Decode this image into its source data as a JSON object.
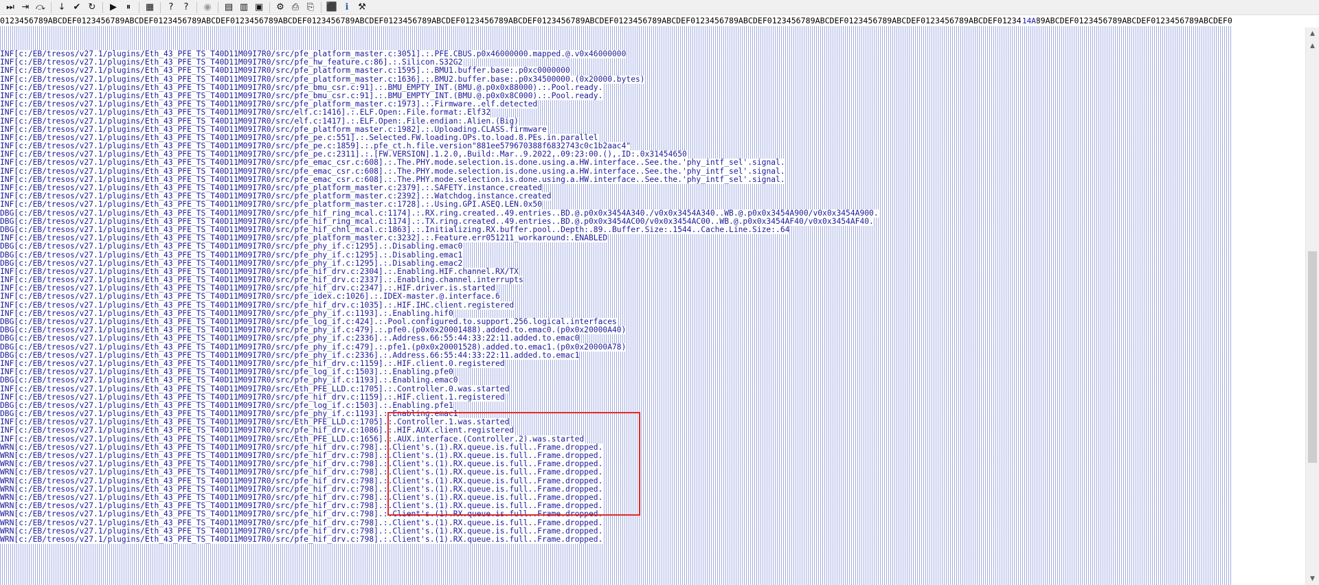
{
  "toolbar": {
    "buttons": [
      {
        "name": "run-to-end-icon",
        "glyph": "⏭"
      },
      {
        "name": "step-into-icon",
        "glyph": "⇥"
      },
      {
        "name": "step-over-icon",
        "glyph": "⤼"
      },
      {
        "name": "step-down-icon",
        "glyph": "↓"
      },
      {
        "name": "check-icon",
        "glyph": "✔"
      },
      {
        "name": "refresh-icon",
        "glyph": "↻"
      },
      {
        "name": "play-icon",
        "glyph": "▶"
      },
      {
        "name": "pause-icon",
        "glyph": "⏸"
      },
      {
        "name": "reset-icon",
        "glyph": "▦"
      },
      {
        "name": "help-icon",
        "glyph": "?"
      },
      {
        "name": "context-help-icon",
        "glyph": "?"
      },
      {
        "name": "disabled-icon",
        "glyph": "◉"
      },
      {
        "name": "grid-icon",
        "glyph": "▤"
      },
      {
        "name": "binary-icon",
        "glyph": "▥"
      },
      {
        "name": "memory-icon",
        "glyph": "▣"
      },
      {
        "name": "settings-icon",
        "glyph": "⚙"
      },
      {
        "name": "print-icon",
        "glyph": "⎙"
      },
      {
        "name": "export-icon",
        "glyph": "⎘"
      },
      {
        "name": "record-icon",
        "glyph": "⬛"
      },
      {
        "name": "info-icon",
        "glyph": "ℹ"
      },
      {
        "name": "tools-icon",
        "glyph": "⚒"
      }
    ]
  },
  "ruler": "0123456789ABCDEF0123456789ABCDEF0123456789ABCDEF0123456789ABCDEF0123456789ABCDEF0123456789ABCDEF0123456789ABCDEF0123456789ABCDEF0123456789ABCDEF0123456789ABCDEF0123456789ABCDEF0123456789ABCDEF0123456789ABCDEF0123456789ABCDEF0123456789ABCDEF0123456789ABCDEF0123456789ABCDEF0123456789ABCDEF",
  "position_label": "14A",
  "log_lines": [
    {
      "level": "INF",
      "src": "c:/EB/tresos/v27.1/plugins/Eth_43_PFE_TS_T40D11M09I7R0/src/pfe_platform_master.c:3051]",
      "msg": ".:.PFE.CBUS.p0x46000000.mapped.@.v0x46000000"
    },
    {
      "level": "INF",
      "src": "c:/EB/tresos/v27.1/plugins/Eth_43_PFE_TS_T40D11M09I7R0/src/pfe_hw_feature.c:86]",
      "msg": ".:.Silicon.S32G2"
    },
    {
      "level": "INF",
      "src": "c:/EB/tresos/v27.1/plugins/Eth_43_PFE_TS_T40D11M09I7R0/src/pfe_platform_master.c:1595]",
      "msg": ".:.BMU1.buffer.base:.p0xc0000000"
    },
    {
      "level": "INF",
      "src": "c:/EB/tresos/v27.1/plugins/Eth_43_PFE_TS_T40D11M09I7R0/src/pfe_platform_master.c:1636]",
      "msg": ".:.BMU2.buffer.base:.p0x34500000.(0x20000.bytes)"
    },
    {
      "level": "INF",
      "src": "c:/EB/tresos/v27.1/plugins/Eth_43_PFE_TS_T40D11M09I7R0/src/pfe_bmu_csr.c:91]",
      "msg": ".:.BMU_EMPTY_INT.(BMU.@.p0x0x88000).:.Pool.ready."
    },
    {
      "level": "INF",
      "src": "c:/EB/tresos/v27.1/plugins/Eth_43_PFE_TS_T40D11M09I7R0/src/pfe_bmu_csr.c:91]",
      "msg": ".:.BMU_EMPTY_INT.(BMU.@.p0x0x8C000).:.Pool.ready."
    },
    {
      "level": "INF",
      "src": "c:/EB/tresos/v27.1/plugins/Eth_43_PFE_TS_T40D11M09I7R0/src/pfe_platform_master.c:1973]",
      "msg": ".:.Firmware..elf.detected"
    },
    {
      "level": "INF",
      "src": "c:/EB/tresos/v27.1/plugins/Eth_43_PFE_TS_T40D11M09I7R0/src/elf.c:1416]",
      "msg": ".:.ELF.Open:.File.format:.Elf32"
    },
    {
      "level": "INF",
      "src": "c:/EB/tresos/v27.1/plugins/Eth_43_PFE_TS_T40D11M09I7R0/src/elf.c:1417]",
      "msg": ".:.ELF.Open:.File.endian:.Alien.(Big)"
    },
    {
      "level": "INF",
      "src": "c:/EB/tresos/v27.1/plugins/Eth_43_PFE_TS_T40D11M09I7R0/src/pfe_platform_master.c:1982]",
      "msg": ".:.Uploading.CLASS.firmware"
    },
    {
      "level": "INF",
      "src": "c:/EB/tresos/v27.1/plugins/Eth_43_PFE_TS_T40D11M09I7R0/src/pfe_pe.c:551]",
      "msg": ".:.Selected.FW.loading.OPs.to.load.8.PEs.in.parallel"
    },
    {
      "level": "INF",
      "src": "c:/EB/tresos/v27.1/plugins/Eth_43_PFE_TS_T40D11M09I7R0/src/pfe_pe.c:1859]",
      "msg": ".:.pfe_ct.h.file.version\"881ee579670388f6832743c0c1b2aac4\""
    },
    {
      "level": "INF",
      "src": "c:/EB/tresos/v27.1/plugins/Eth_43_PFE_TS_T40D11M09I7R0/src/pfe_pe.c:2311]",
      "msg": ".:.[FW.VERSION].1.2.0,.Build:.Mar..9.2022,.09:23:00.(),.ID:.0x31454650"
    },
    {
      "level": "INF",
      "src": "c:/EB/tresos/v27.1/plugins/Eth_43_PFE_TS_T40D11M09I7R0/src/pfe_emac_csr.c:608]",
      "msg": ".:.The.PHY.mode.selection.is.done.using.a.HW.interface..See.the.'phy_intf_sel'.signal."
    },
    {
      "level": "INF",
      "src": "c:/EB/tresos/v27.1/plugins/Eth_43_PFE_TS_T40D11M09I7R0/src/pfe_emac_csr.c:608]",
      "msg": ".:.The.PHY.mode.selection.is.done.using.a.HW.interface..See.the.'phy_intf_sel'.signal."
    },
    {
      "level": "INF",
      "src": "c:/EB/tresos/v27.1/plugins/Eth_43_PFE_TS_T40D11M09I7R0/src/pfe_emac_csr.c:608]",
      "msg": ".:.The.PHY.mode.selection.is.done.using.a.HW.interface..See.the.'phy_intf_sel'.signal."
    },
    {
      "level": "INF",
      "src": "c:/EB/tresos/v27.1/plugins/Eth_43_PFE_TS_T40D11M09I7R0/src/pfe_platform_master.c:2379]",
      "msg": ".:.SAFETY.instance.created"
    },
    {
      "level": "INF",
      "src": "c:/EB/tresos/v27.1/plugins/Eth_43_PFE_TS_T40D11M09I7R0/src/pfe_platform_master.c:2392]",
      "msg": ".:.Watchdog.instance.created"
    },
    {
      "level": "INF",
      "src": "c:/EB/tresos/v27.1/plugins/Eth_43_PFE_TS_T40D11M09I7R0/src/pfe_platform_master.c:1728]",
      "msg": ".:.Using.GPI.ASEQ.LEN.0x50"
    },
    {
      "level": "DBG",
      "src": "c:/EB/tresos/v27.1/plugins/Eth_43_PFE_TS_T40D11M09I7R0/src/pfe_hif_ring_mcal.c:1174]",
      "msg": ".:.RX.ring.created..49.entries..BD.@.p0x0x3454A340./v0x0x3454A340..WB.@.p0x0x3454A900/v0x0x3454A900."
    },
    {
      "level": "DBG",
      "src": "c:/EB/tresos/v27.1/plugins/Eth_43_PFE_TS_T40D11M09I7R0/src/pfe_hif_ring_mcal.c:1174]",
      "msg": ".:.TX.ring.created..49.entries..BD.@.p0x0x3454AC00/v0x0x3454AC00..WB.@.p0x0x3454AF40/v0x0x3454AF40."
    },
    {
      "level": "DBG",
      "src": "c:/EB/tresos/v27.1/plugins/Eth_43_PFE_TS_T40D11M09I7R0/src/pfe_hif_chnl_mcal.c:1863]",
      "msg": ".:.Initializing.RX.buffer.pool..Depth:.89..Buffer.Size:.1544..Cache.Line.Size:.64"
    },
    {
      "level": "INF",
      "src": "c:/EB/tresos/v27.1/plugins/Eth_43_PFE_TS_T40D11M09I7R0/src/pfe_platform_master.c:3232]",
      "msg": ".:.Feature.err051211_workaround:.ENABLED"
    },
    {
      "level": "DBG",
      "src": "c:/EB/tresos/v27.1/plugins/Eth_43_PFE_TS_T40D11M09I7R0/src/pfe_phy_if.c:1295]",
      "msg": ".:.Disabling.emac0"
    },
    {
      "level": "DBG",
      "src": "c:/EB/tresos/v27.1/plugins/Eth_43_PFE_TS_T40D11M09I7R0/src/pfe_phy_if.c:1295]",
      "msg": ".:.Disabling.emac1"
    },
    {
      "level": "DBG",
      "src": "c:/EB/tresos/v27.1/plugins/Eth_43_PFE_TS_T40D11M09I7R0/src/pfe_phy_if.c:1295]",
      "msg": ".:.Disabling.emac2"
    },
    {
      "level": "INF",
      "src": "c:/EB/tresos/v27.1/plugins/Eth_43_PFE_TS_T40D11M09I7R0/src/pfe_hif_drv.c:2304]",
      "msg": ".:.Enabling.HIF.channel.RX/TX"
    },
    {
      "level": "INF",
      "src": "c:/EB/tresos/v27.1/plugins/Eth_43_PFE_TS_T40D11M09I7R0/src/pfe_hif_drv.c:2337]",
      "msg": ".:.Enabling.channel.interrupts"
    },
    {
      "level": "INF",
      "src": "c:/EB/tresos/v27.1/plugins/Eth_43_PFE_TS_T40D11M09I7R0/src/pfe_hif_drv.c:2347]",
      "msg": ".:.HIF.driver.is.started"
    },
    {
      "level": "INF",
      "src": "c:/EB/tresos/v27.1/plugins/Eth_43_PFE_TS_T40D11M09I7R0/src/pfe_idex.c:1026]",
      "msg": ".:.IDEX-master.@.interface.6"
    },
    {
      "level": "INF",
      "src": "c:/EB/tresos/v27.1/plugins/Eth_43_PFE_TS_T40D11M09I7R0/src/pfe_hif_drv.c:1035]",
      "msg": ".:.HIF.IHC.client.registered"
    },
    {
      "level": "INF",
      "src": "c:/EB/tresos/v27.1/plugins/Eth_43_PFE_TS_T40D11M09I7R0/src/pfe_phy_if.c:1193]",
      "msg": ".:.Enabling.hif0"
    },
    {
      "level": "DBG",
      "src": "c:/EB/tresos/v27.1/plugins/Eth_43_PFE_TS_T40D11M09I7R0/src/pfe_log_if.c:424]",
      "msg": ".:.Pool.configured.to.support.256.logical.interfaces"
    },
    {
      "level": "DBG",
      "src": "c:/EB/tresos/v27.1/plugins/Eth_43_PFE_TS_T40D11M09I7R0/src/pfe_phy_if.c:479]",
      "msg": ".:.pfe0.(p0x0x20001488).added.to.emac0.(p0x0x20000A40)"
    },
    {
      "level": "DBG",
      "src": "c:/EB/tresos/v27.1/plugins/Eth_43_PFE_TS_T40D11M09I7R0/src/pfe_phy_if.c:2336]",
      "msg": ".:.Address.66:55:44:33:22:11.added.to.emac0"
    },
    {
      "level": "DBG",
      "src": "c:/EB/tresos/v27.1/plugins/Eth_43_PFE_TS_T40D11M09I7R0/src/pfe_phy_if.c:479]",
      "msg": ".:.pfe1.(p0x0x20001528).added.to.emac1.(p0x0x20000A78)"
    },
    {
      "level": "DBG",
      "src": "c:/EB/tresos/v27.1/plugins/Eth_43_PFE_TS_T40D11M09I7R0/src/pfe_phy_if.c:2336]",
      "msg": ".:.Address.66:55:44:33:22:11.added.to.emac1"
    },
    {
      "level": "INF",
      "src": "c:/EB/tresos/v27.1/plugins/Eth_43_PFE_TS_T40D11M09I7R0/src/pfe_hif_drv.c:1159]",
      "msg": ".:.HIF.client.0.registered"
    },
    {
      "level": "INF",
      "src": "c:/EB/tresos/v27.1/plugins/Eth_43_PFE_TS_T40D11M09I7R0/src/pfe_log_if.c:1503]",
      "msg": ".:.Enabling.pfe0"
    },
    {
      "level": "DBG",
      "src": "c:/EB/tresos/v27.1/plugins/Eth_43_PFE_TS_T40D11M09I7R0/src/pfe_phy_if.c:1193]",
      "msg": ".:.Enabling.emac0"
    },
    {
      "level": "INF",
      "src": "c:/EB/tresos/v27.1/plugins/Eth_43_PFE_TS_T40D11M09I7R0/src/Eth_PFE_LLD.c:1705]",
      "msg": ".:.Controller.0.was.started"
    },
    {
      "level": "INF",
      "src": "c:/EB/tresos/v27.1/plugins/Eth_43_PFE_TS_T40D11M09I7R0/src/pfe_hif_drv.c:1159]",
      "msg": ".:.HIF.client.1.registered"
    },
    {
      "level": "DBG",
      "src": "c:/EB/tresos/v27.1/plugins/Eth_43_PFE_TS_T40D11M09I7R0/src/pfe_log_if.c:1503]",
      "msg": ".:.Enabling.pfe1"
    },
    {
      "level": "DBG",
      "src": "c:/EB/tresos/v27.1/plugins/Eth_43_PFE_TS_T40D11M09I7R0/src/pfe_phy_if.c:1193]",
      "msg": ".:.Enabling.emac1"
    },
    {
      "level": "INF",
      "src": "c:/EB/tresos/v27.1/plugins/Eth_43_PFE_TS_T40D11M09I7R0/src/Eth_PFE_LLD.c:1705]",
      "msg": ".:.Controller.1.was.started"
    },
    {
      "level": "INF",
      "src": "c:/EB/tresos/v27.1/plugins/Eth_43_PFE_TS_T40D11M09I7R0/src/pfe_hif_drv.c:1086]",
      "msg": ".:.HIF.AUX.client.registered"
    },
    {
      "level": "INF",
      "src": "c:/EB/tresos/v27.1/plugins/Eth_43_PFE_TS_T40D11M09I7R0/src/Eth_PFE_LLD.c:1656]",
      "msg": ".:.AUX.interface.(Controller.2).was.started"
    },
    {
      "level": "WRN",
      "src": "c:/EB/tresos/v27.1/plugins/Eth_43_PFE_TS_T40D11M09I7R0/src/pfe_hif_drv.c:798]",
      "msg": ".:.Client's.(1).RX.queue.is.full..Frame.dropped."
    },
    {
      "level": "WRN",
      "src": "c:/EB/tresos/v27.1/plugins/Eth_43_PFE_TS_T40D11M09I7R0/src/pfe_hif_drv.c:798]",
      "msg": ".:.Client's.(1).RX.queue.is.full..Frame.dropped."
    },
    {
      "level": "WRN",
      "src": "c:/EB/tresos/v27.1/plugins/Eth_43_PFE_TS_T40D11M09I7R0/src/pfe_hif_drv.c:798]",
      "msg": ".:.Client's.(1).RX.queue.is.full..Frame.dropped."
    },
    {
      "level": "WRN",
      "src": "c:/EB/tresos/v27.1/plugins/Eth_43_PFE_TS_T40D11M09I7R0/src/pfe_hif_drv.c:798]",
      "msg": ".:.Client's.(1).RX.queue.is.full..Frame.dropped."
    },
    {
      "level": "WRN",
      "src": "c:/EB/tresos/v27.1/plugins/Eth_43_PFE_TS_T40D11M09I7R0/src/pfe_hif_drv.c:798]",
      "msg": ".:.Client's.(1).RX.queue.is.full..Frame.dropped."
    },
    {
      "level": "WRN",
      "src": "c:/EB/tresos/v27.1/plugins/Eth_43_PFE_TS_T40D11M09I7R0/src/pfe_hif_drv.c:798]",
      "msg": ".:.Client's.(1).RX.queue.is.full..Frame.dropped."
    },
    {
      "level": "WRN",
      "src": "c:/EB/tresos/v27.1/plugins/Eth_43_PFE_TS_T40D11M09I7R0/src/pfe_hif_drv.c:798]",
      "msg": ".:.Client's.(1).RX.queue.is.full..Frame.dropped."
    },
    {
      "level": "WRN",
      "src": "c:/EB/tresos/v27.1/plugins/Eth_43_PFE_TS_T40D11M09I7R0/src/pfe_hif_drv.c:798]",
      "msg": ".:.Client's.(1).RX.queue.is.full..Frame.dropped."
    },
    {
      "level": "WRN",
      "src": "c:/EB/tresos/v27.1/plugins/Eth_43_PFE_TS_T40D11M09I7R0/src/pfe_hif_drv.c:798]",
      "msg": ".:.Client's.(1).RX.queue.is.full..Frame.dropped."
    },
    {
      "level": "WRN",
      "src": "c:/EB/tresos/v27.1/plugins/Eth_43_PFE_TS_T40D11M09I7R0/src/pfe_hif_drv.c:798]",
      "msg": ".:.Client's.(1).RX.queue.is.full..Frame.dropped."
    },
    {
      "level": "WRN",
      "src": "c:/EB/tresos/v27.1/plugins/Eth_43_PFE_TS_T40D11M09I7R0/src/pfe_hif_drv.c:798]",
      "msg": ".:.Client's.(1).RX.queue.is.full..Frame.dropped."
    },
    {
      "level": "WRN",
      "src": "c:/EB/tresos/v27.1/plugins/Eth_43_PFE_TS_T40D11M09I7R0/src/pfe_hif_drv.c:798]",
      "msg": ".:.Client's.(1).RX.queue.is.full..Frame.dropped."
    }
  ],
  "colors": {
    "text": "#1a1a99",
    "highlight_border": "#e0282a",
    "toolbar_bg": "#f0f0f0"
  }
}
